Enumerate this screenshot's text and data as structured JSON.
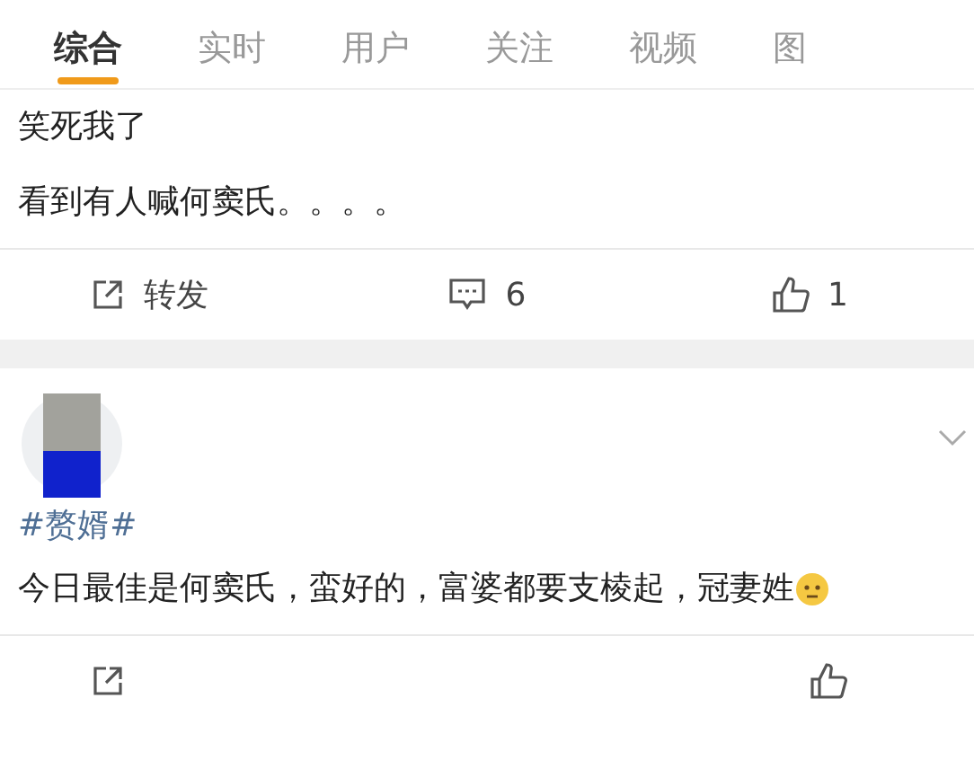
{
  "tabs": [
    {
      "label": "综合",
      "selected": true
    },
    {
      "label": "实时",
      "selected": false
    },
    {
      "label": "用户",
      "selected": false
    },
    {
      "label": "关注",
      "selected": false
    },
    {
      "label": "视频",
      "selected": false
    },
    {
      "label": "图",
      "selected": false
    }
  ],
  "posts": [
    {
      "lines": [
        "笑死我了",
        "看到有人喊何窦氏。。。。"
      ],
      "actions": {
        "repost": "转发",
        "comments": "6",
        "likes": "1"
      }
    },
    {
      "avatar": {
        "kind": "picture"
      },
      "hashtag": "#赘婿#",
      "lines": [
        "今日最佳是何窦氏，蛮好的，富婆都要支棱起，冠妻姓"
      ],
      "emoji": true
    }
  ]
}
